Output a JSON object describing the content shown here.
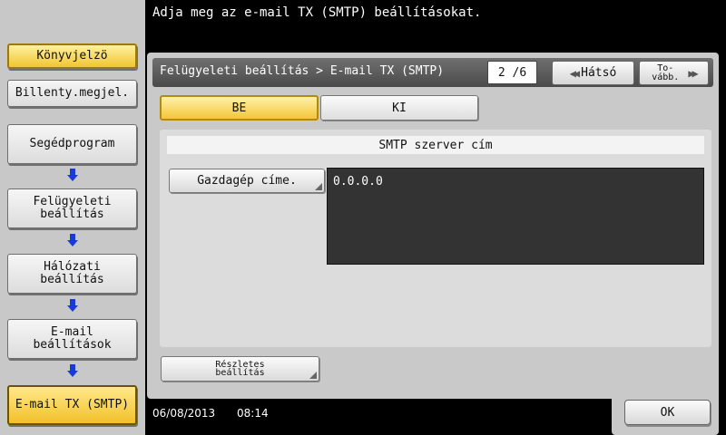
{
  "instruction": "Adja meg az e-mail TX (SMTP) beállításokat.",
  "sidebar": {
    "address_book": "Könyvjelzö",
    "keyboard": "Billenty.megjel.",
    "path": [
      "Segédprogram",
      "Felügyeleti\nbeállítás",
      "Hálózati\nbeállítás",
      "E-mail\nbeállítások",
      "E-mail TX (SMTP)"
    ]
  },
  "header": {
    "breadcrumb": "Felügyeleti beállítás > E-mail TX (SMTP)",
    "page_indicator": "2 /6",
    "back_label": "Hátsó",
    "next_label": "To-\nvább."
  },
  "toggle": {
    "on_label": "BE",
    "off_label": "KI",
    "selected": "BE"
  },
  "smtp": {
    "section_title": "SMTP szerver cím",
    "host_button": "Gazdagép címe.",
    "host_value": "0.0.0.0"
  },
  "detail_button": "Részletes\nbeállítás",
  "status": {
    "date": "06/08/2013",
    "time": "08:14"
  },
  "ok_label": "OK",
  "colors": {
    "accent_yellow": "#f3c63a",
    "nav_arrow": "#1a3ad8",
    "header_dark": "#4a4a4a"
  }
}
